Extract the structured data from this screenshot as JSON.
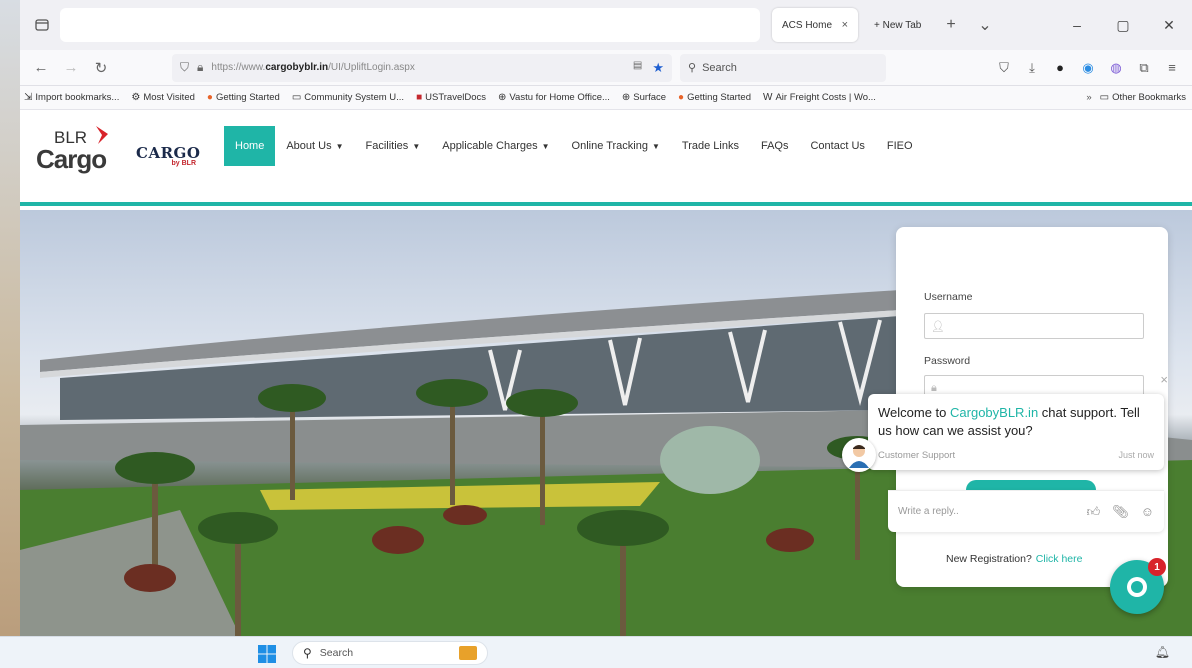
{
  "browser": {
    "tabs": [
      {
        "label": "ACS Home",
        "close": "×"
      },
      {
        "label": "+ New Tab"
      }
    ],
    "new_tab_symbol": "+",
    "tab_list_symbol": "⌄",
    "window_controls": [
      "–",
      "▢",
      "✕"
    ],
    "url": {
      "prefix": "https://www.",
      "host": "cargobyblr.in",
      "path": "/UI/UpliftLogin.aspx"
    },
    "search_placeholder": "Search",
    "bookmarks": [
      {
        "label": "Import bookmarks...",
        "icon": "import-icon"
      },
      {
        "label": "Most Visited",
        "icon": "gear-icon"
      },
      {
        "label": "Getting Started",
        "icon": "firefox-icon"
      },
      {
        "label": "Community System U...",
        "icon": "folder-icon"
      },
      {
        "label": "USTravelDocs",
        "icon": "flag-icon"
      },
      {
        "label": "Vastu for Home Office...",
        "icon": "globe-icon"
      },
      {
        "label": "Surface",
        "icon": "globe-icon"
      },
      {
        "label": "Getting Started",
        "icon": "firefox-icon"
      },
      {
        "label": "Air Freight Costs | Wo...",
        "icon": "w-icon"
      }
    ],
    "bookmarks_more": "»",
    "other_bookmarks": "Other Bookmarks"
  },
  "site": {
    "logo_top": "BLR",
    "logo_main": "Cargo",
    "cargo_logo": "CARGO",
    "cargo_logo_sub": "by BLR",
    "menu": [
      {
        "label": "Home",
        "caret": ""
      },
      {
        "label": "About Us",
        "caret": "▼"
      },
      {
        "label": "Facilities",
        "caret": "▼"
      },
      {
        "label": "Applicable Charges",
        "caret": "▼"
      },
      {
        "label": "Online Tracking",
        "caret": "▼"
      },
      {
        "label": "Trade Links",
        "caret": ""
      },
      {
        "label": "FAQs",
        "caret": ""
      },
      {
        "label": "Contact Us",
        "caret": ""
      },
      {
        "label": "FIEO",
        "caret": ""
      }
    ],
    "login": {
      "username_label": "Username",
      "password_label": "Password",
      "new_registration": "New Registration?",
      "click_here": "Click here"
    }
  },
  "chat": {
    "welcome_pre": "Welcome to ",
    "brand": "CargobyBLR.in",
    "welcome_post": " chat support. Tell us how can we assist you?",
    "agent": "Customer Support",
    "time": "Just now",
    "reply_placeholder": "Write a reply..",
    "close": "×",
    "badge": "1"
  },
  "taskbar": {
    "search": "Search"
  },
  "colors": {
    "accent": "#1fb5a7",
    "badge": "#d8232a"
  }
}
